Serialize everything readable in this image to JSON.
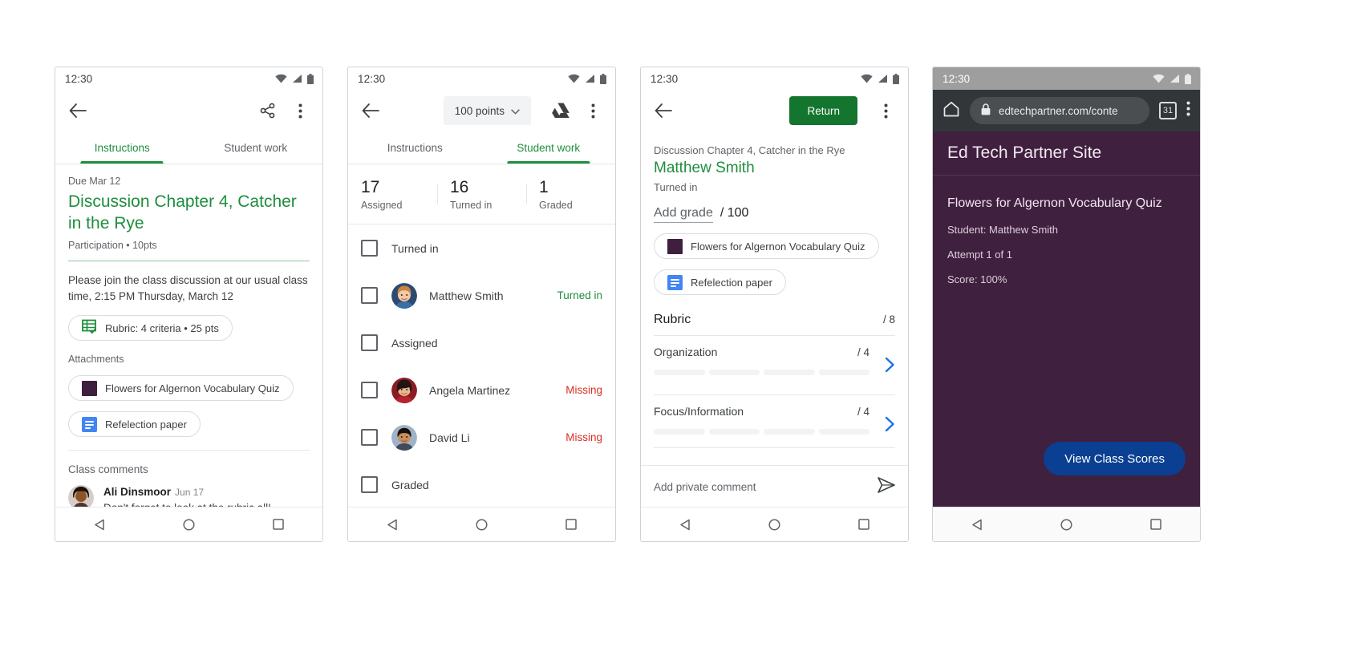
{
  "status_bar": {
    "time": "12:30"
  },
  "panel1": {
    "tabs": [
      {
        "label": "Instructions",
        "active": true
      },
      {
        "label": "Student work",
        "active": false
      }
    ],
    "due": "Due Mar 12",
    "title": "Discussion Chapter 4, Catcher in the Rye",
    "subtitle": "Participation • 10pts",
    "description": "Please join the class discussion at our usual class time, 2:15 PM Thursday, March 12",
    "rubric_chip": "Rubric: 4 criteria • 25 pts",
    "attachments_label": "Attachments",
    "attachments": [
      {
        "label": "Flowers for Algernon Vocabulary Quiz",
        "icon": "quiz-swatch"
      },
      {
        "label": "Refelection paper",
        "icon": "doc-icon"
      }
    ],
    "comments_label": "Class comments",
    "comment": {
      "author": "Ali Dinsmoor",
      "date": "Jun 17",
      "text": "Don't forget to look at the rubric all!"
    }
  },
  "panel2": {
    "points_button": "100 points",
    "tabs": [
      {
        "label": "Instructions",
        "active": false
      },
      {
        "label": "Student work",
        "active": true
      }
    ],
    "stats": [
      {
        "num": "17",
        "label": "Assigned"
      },
      {
        "num": "16",
        "label": "Turned in"
      },
      {
        "num": "1",
        "label": "Graded"
      }
    ],
    "rows": [
      {
        "type": "group",
        "name": "Turned in",
        "status": "",
        "status_kind": ""
      },
      {
        "type": "student",
        "name": "Matthew Smith",
        "status": "Turned in",
        "status_kind": "turned",
        "avatar": "boy-blond"
      },
      {
        "type": "group",
        "name": "Assigned",
        "status": "",
        "status_kind": ""
      },
      {
        "type": "student",
        "name": "Angela Martinez",
        "status": "Missing",
        "status_kind": "missing",
        "avatar": "girl-red"
      },
      {
        "type": "student",
        "name": "David Li",
        "status": "Missing",
        "status_kind": "missing",
        "avatar": "boy-dark"
      },
      {
        "type": "group",
        "name": "Graded",
        "status": "",
        "status_kind": ""
      }
    ]
  },
  "panel3": {
    "return_button": "Return",
    "assignment": "Discussion Chapter 4, Catcher in the Rye",
    "student": "Matthew Smith",
    "state": "Turned in",
    "add_grade": "Add grade",
    "out_of": "/ 100",
    "attachments": [
      {
        "label": "Flowers for Algernon Vocabulary Quiz",
        "icon": "quiz-swatch"
      },
      {
        "label": "Refelection paper",
        "icon": "doc-icon"
      }
    ],
    "rubric": {
      "title": "Rubric",
      "total": "/ 8",
      "criteria": [
        {
          "name": "Organization",
          "value": "/ 4",
          "segments": 4
        },
        {
          "name": "Focus/Information",
          "value": "/ 4",
          "segments": 4
        }
      ]
    },
    "private_comment_placeholder": "Add private comment"
  },
  "panel4": {
    "url": "edtechpartner.com/conte",
    "tab_count": "31",
    "site_title": "Ed Tech Partner Site",
    "page_title": "Flowers for Algernon Vocabulary Quiz",
    "lines": [
      "Student: Matthew Smith",
      "Attempt 1 of 1",
      "Score: 100%"
    ],
    "view_button": "View Class Scores"
  },
  "colors": {
    "green": "#1e8e3e",
    "return_green": "#13752e",
    "red": "#d93025",
    "blue_chevron": "#1a73e8",
    "plum": "#40203f",
    "button_blue": "#0b3f91",
    "quiz_swatch": "#3e1f3d"
  },
  "nav": {
    "back": "back-triangle",
    "home": "home-circle",
    "recents": "recents-square"
  }
}
